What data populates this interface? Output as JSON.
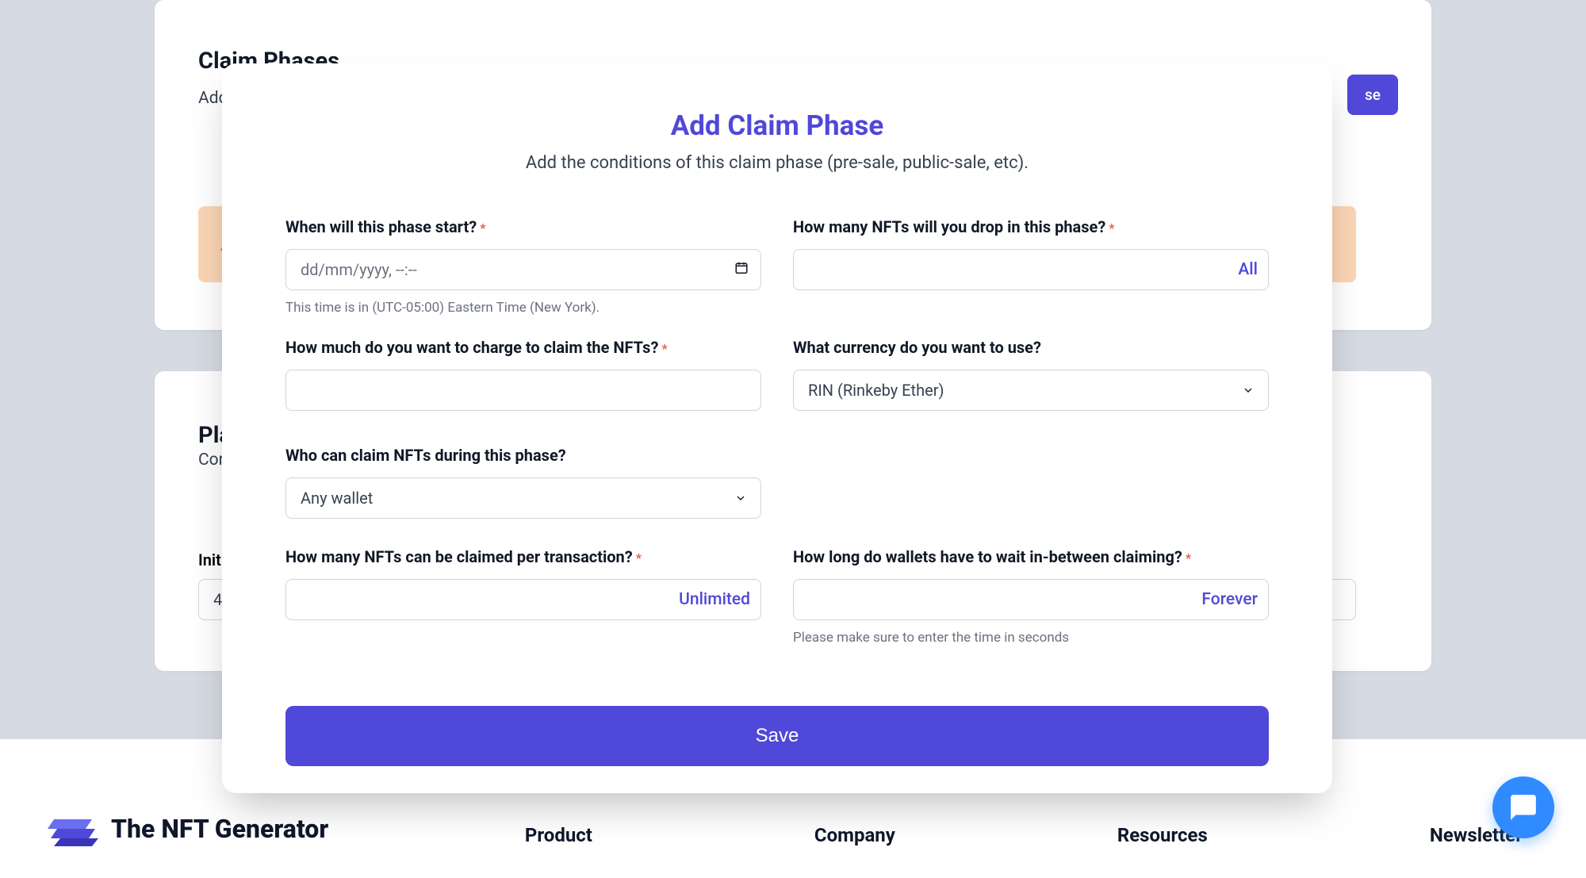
{
  "background": {
    "card1_title": "Claim Phases",
    "card1_sub_prefix": "Add",
    "add_phase_btn_suffix": "se",
    "card2_title_prefix": "Pla",
    "card2_sub_prefix": "Cor",
    "init_label_prefix": "Init",
    "init_value_prefix": "4."
  },
  "modal": {
    "title": "Add Claim Phase",
    "subtitle": "Add the conditions of this claim phase (pre-sale, public-sale, etc).",
    "fields": {
      "start": {
        "label": "When will this phase start?",
        "required": true,
        "placeholder": "dd/mm/yyyy, --:--",
        "helper": "This time is in (UTC-05:00) Eastern Time (New York)."
      },
      "supply": {
        "label": "How many NFTs will you drop in this phase?",
        "required": true,
        "suffix_action": "All"
      },
      "price": {
        "label": "How much do you want to charge to claim the NFTs?",
        "required": true
      },
      "currency": {
        "label": "What currency do you want to use?",
        "required": false,
        "selected": "RIN (Rinkeby Ether)"
      },
      "allowlist": {
        "label": "Who can claim NFTs during this phase?",
        "required": false,
        "selected": "Any wallet"
      },
      "per_tx": {
        "label": "How many NFTs can be claimed per transaction?",
        "required": true,
        "suffix_action": "Unlimited"
      },
      "cooldown": {
        "label": "How long do wallets have to wait in-between claiming?",
        "required": true,
        "suffix_action": "Forever",
        "helper": "Please make sure to enter the time in seconds"
      }
    },
    "save_label": "Save"
  },
  "footer": {
    "brand": "The NFT Generator",
    "columns": [
      "Product",
      "Company",
      "Resources",
      "Newsletter"
    ]
  }
}
